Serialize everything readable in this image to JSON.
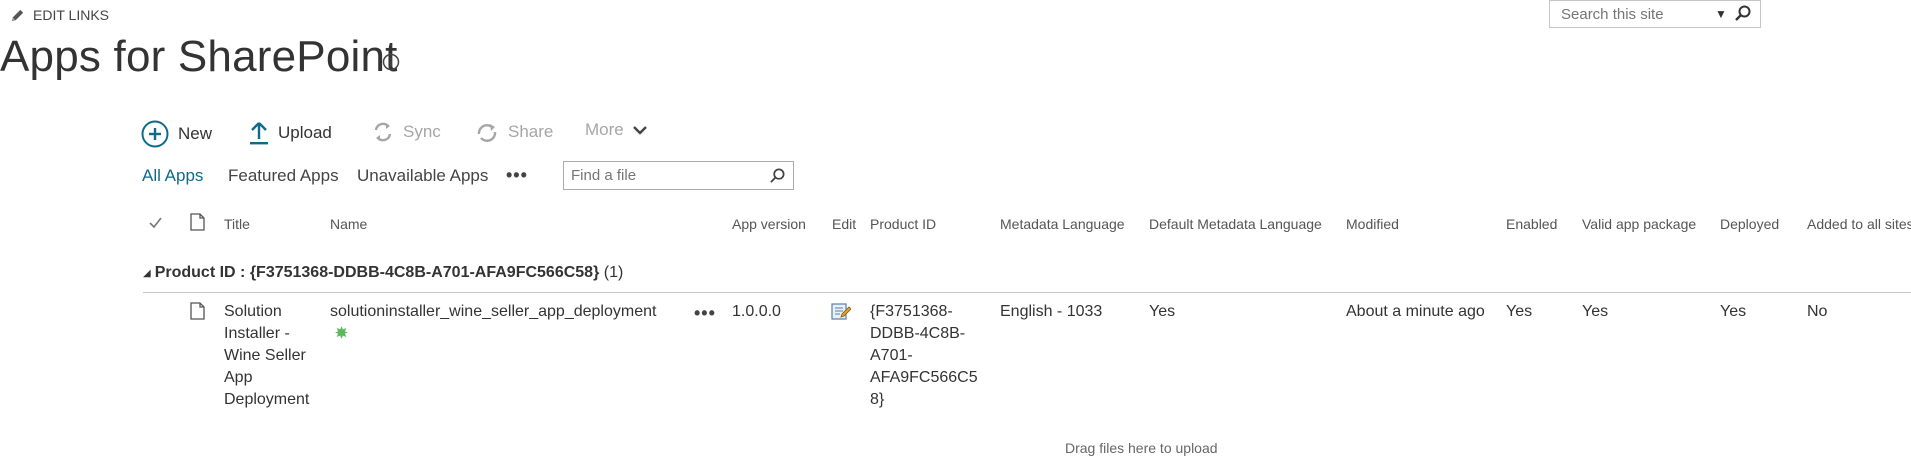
{
  "header": {
    "edit_links": "EDIT LINKS",
    "search_placeholder": "Search this site",
    "page_title": "Apps for SharePoint"
  },
  "commands": {
    "new": "New",
    "upload": "Upload",
    "sync": "Sync",
    "share": "Share",
    "more": "More"
  },
  "views": {
    "all_apps": "All Apps",
    "featured_apps": "Featured Apps",
    "unavailable_apps": "Unavailable Apps",
    "ellipsis": "•••",
    "find_placeholder": "Find a file"
  },
  "columns": {
    "title": "Title",
    "name": "Name",
    "app_version": "App version",
    "edit": "Edit",
    "product_id": "Product ID",
    "metadata_language": "Metadata Language",
    "default_metadata_language": "Default Metadata Language",
    "modified": "Modified",
    "enabled": "Enabled",
    "valid_app_package": "Valid app package",
    "deployed": "Deployed",
    "added_to_all_sites": "Added to all sites"
  },
  "group": {
    "label": "Product ID : ",
    "value": "{F3751368-DDBB-4C8B-A701-AFA9FC566C58}",
    "count": " (1)"
  },
  "row": {
    "title": "Solution Installer - Wine Seller App Deployment",
    "name": "solutioninstaller_wine_seller_app_deployment",
    "ellipsis": "•••",
    "app_version": "1.0.0.0",
    "product_id": "{F3751368-DDBB-4C8B-A701-AFA9FC566C58}",
    "metadata_language": "English - 1033",
    "default_metadata_language": "Yes",
    "modified": "About a minute ago",
    "enabled": "Yes",
    "valid_app_package": "Yes",
    "deployed": "Yes",
    "added_to_all_sites": "No"
  },
  "footer": {
    "drag_hint": "Drag files here to upload"
  },
  "colors": {
    "accent": "#0f6a8a",
    "disabled": "#a6a6a6",
    "new_icon": "#5cb85c"
  }
}
